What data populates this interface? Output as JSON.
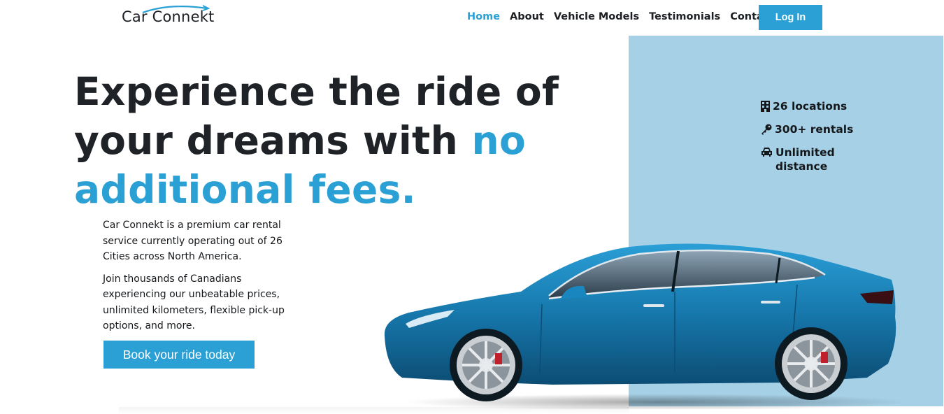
{
  "brand": {
    "name": "Car Connekt"
  },
  "nav": {
    "items": [
      {
        "label": "Home",
        "active": true
      },
      {
        "label": "About"
      },
      {
        "label": "Vehicle Models"
      },
      {
        "label": "Testimonials"
      },
      {
        "label": "Contact"
      }
    ],
    "login_label": "Log In"
  },
  "hero": {
    "title_main": "Experience the ride of your dreams with ",
    "title_accent": "no additional fees.",
    "paragraph_1": "Car Connekt is a premium car rental service currently operating out of 26 Cities across North America.",
    "paragraph_2": "Join thousands of Canadians experiencing our unbeatable prices, unlimited kilometers, flexible pick-up options, and more.",
    "cta_label": "Book your ride today"
  },
  "stats": [
    {
      "icon": "building-icon",
      "label": "26 locations"
    },
    {
      "icon": "key-icon",
      "label": "300+ rentals"
    },
    {
      "icon": "car-icon",
      "label": "Unlimited distance"
    }
  ],
  "colors": {
    "accent": "#2aa0d4",
    "panel": "#a6d0e6",
    "text": "#1f2328",
    "car_body": "#1a7fb5"
  }
}
